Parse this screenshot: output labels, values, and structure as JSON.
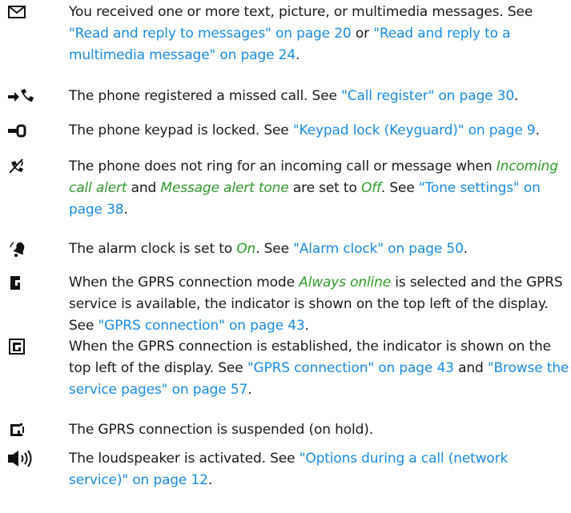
{
  "entries": [
    {
      "icon": "envelope-icon",
      "segments": [
        {
          "t": "text",
          "v": "You received one or more text, picture, or multimedia messages. See "
        },
        {
          "t": "link",
          "v": "\"Read and reply to messages\" on page 20"
        },
        {
          "t": "text",
          "v": " or "
        },
        {
          "t": "link",
          "v": "\"Read and reply to a multimedia message\" on page 24"
        },
        {
          "t": "text",
          "v": "."
        }
      ]
    },
    {
      "icon": "missed-call-icon",
      "segments": [
        {
          "t": "text",
          "v": "The phone registered a missed call. See "
        },
        {
          "t": "link",
          "v": "\"Call register\" on page 30"
        },
        {
          "t": "text",
          "v": "."
        }
      ]
    },
    {
      "icon": "key-lock-icon",
      "segments": [
        {
          "t": "text",
          "v": "The phone keypad is locked. See "
        },
        {
          "t": "link",
          "v": "\"Keypad lock (Keyguard)\" on page 9"
        },
        {
          "t": "text",
          "v": "."
        }
      ]
    },
    {
      "icon": "silent-icon",
      "segments": [
        {
          "t": "text",
          "v": "The phone does not ring for an incoming call or message when "
        },
        {
          "t": "term",
          "v": "Incoming call alert"
        },
        {
          "t": "text",
          "v": " and "
        },
        {
          "t": "term",
          "v": "Message alert tone"
        },
        {
          "t": "text",
          "v": " are set to "
        },
        {
          "t": "term",
          "v": "Off"
        },
        {
          "t": "text",
          "v": ". See "
        },
        {
          "t": "link",
          "v": "\"Tone settings\" on page 38"
        },
        {
          "t": "text",
          "v": "."
        }
      ]
    },
    {
      "icon": "alarm-bell-icon",
      "segments": [
        {
          "t": "text",
          "v": "The alarm clock is set to "
        },
        {
          "t": "term",
          "v": "On"
        },
        {
          "t": "text",
          "v": ". See "
        },
        {
          "t": "link",
          "v": "\"Alarm clock\" on page 50"
        },
        {
          "t": "text",
          "v": "."
        }
      ]
    },
    {
      "icon": "gprs-online-icon",
      "segments": [
        {
          "t": "text",
          "v": "When the GPRS connection mode "
        },
        {
          "t": "term",
          "v": "Always online"
        },
        {
          "t": "text",
          "v": " is selected and the GPRS service is available, the indicator is shown on the top left of the display. See "
        },
        {
          "t": "link",
          "v": "\"GPRS connection\" on page 43"
        },
        {
          "t": "text",
          "v": "."
        }
      ]
    },
    {
      "icon": "gprs-connected-icon",
      "segments": [
        {
          "t": "text",
          "v": "When the GPRS connection is established, the indicator is shown on the top left of the display. See "
        },
        {
          "t": "link",
          "v": "\"GPRS connection\" on page 43"
        },
        {
          "t": "text",
          "v": " and "
        },
        {
          "t": "link",
          "v": "\"Browse the service pages\" on page 57"
        },
        {
          "t": "text",
          "v": "."
        }
      ]
    },
    {
      "icon": "gprs-suspended-icon",
      "segments": [
        {
          "t": "text",
          "v": "The GPRS connection is suspended (on hold)."
        }
      ]
    },
    {
      "icon": "loudspeaker-icon",
      "segments": [
        {
          "t": "text",
          "v": "The loudspeaker is activated. See "
        },
        {
          "t": "link",
          "v": "\"Options during a call (network service)\" on page 12"
        },
        {
          "t": "text",
          "v": "."
        }
      ]
    }
  ]
}
